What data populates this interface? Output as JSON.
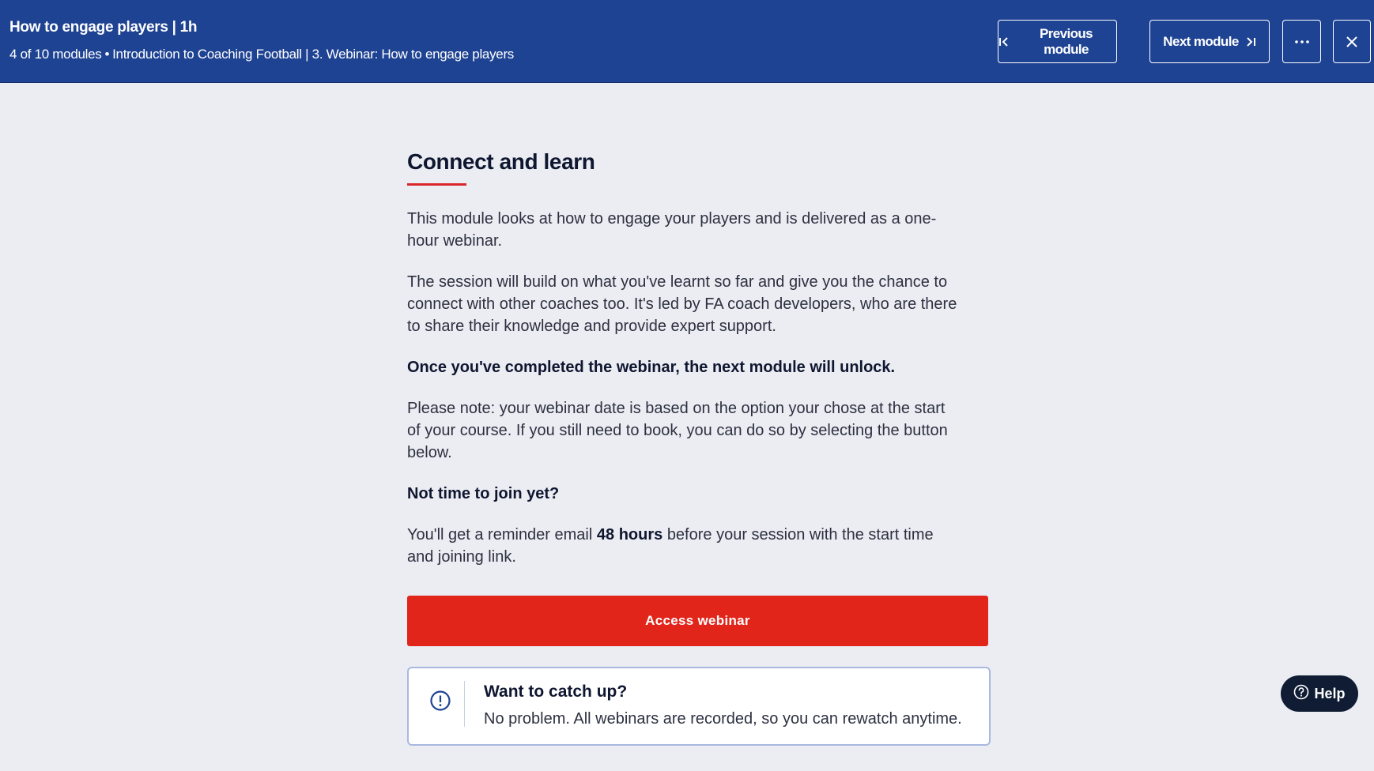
{
  "header": {
    "title": "How to engage players | 1h",
    "progress": "4 of 10 modules",
    "separator": "•",
    "breadcrumb": "Introduction to Coaching Football | 3. Webinar: How to engage players",
    "prev_label": "Previous module",
    "next_label": "Next module",
    "icons": {
      "prev": "skip-previous-icon",
      "next": "skip-next-icon",
      "more": "more-horizontal-icon",
      "close": "close-icon"
    }
  },
  "content": {
    "heading": "Connect and learn",
    "para1": "This module looks at how to engage your players and is delivered as a one-hour webinar.",
    "para2": "The session will build on what you've learnt so far and give you the chance to connect with other coaches too. It's led by FA coach developers, who are there to share their knowledge and provide expert support.",
    "para3": "Once you've completed the webinar, the next module will unlock.",
    "para4": "Please note: your webinar date is based on the option your chose at the start of your course. If you still need to book, you can do so by selecting the button below.",
    "subheading": "Not time to join yet?",
    "reminder_before": "You'll get a reminder email",
    "reminder_bold": "48 hours",
    "reminder_after": "before your session with the start time and joining link.",
    "cta_label": "Access webinar"
  },
  "info": {
    "icon": "info-circle-icon",
    "title": "Want to catch up?",
    "text": "No problem. All webinars are recorded, so you can rewatch anytime."
  },
  "help": {
    "icon": "question-circle-icon",
    "label": "Help"
  },
  "colors": {
    "header_bg": "#1f4393",
    "page_bg": "#ebedf2",
    "accent_red": "#e1251b",
    "help_bg": "#0f1c33"
  }
}
